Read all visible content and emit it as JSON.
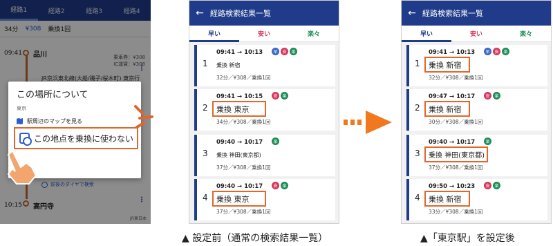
{
  "left_panel": {
    "tabs": [
      "経路1",
      "経路2",
      "経路3",
      "経路4"
    ],
    "summary": {
      "duration": "34分",
      "fare": "¥308",
      "transfers": "乗換1回"
    },
    "origin": {
      "time": "09:41",
      "station": "品川"
    },
    "meta": [
      "乗車券：¥308",
      "IC運賃：¥308"
    ],
    "rail_line": "JR京浜東北線(大船/磯子/桜木町) 東京行",
    "dest": {
      "time": "10:15",
      "station": "高円寺"
    },
    "diagram_link": "前後のダイヤで検索",
    "logo": "JR東日本",
    "kebab": "⋮",
    "dialog": {
      "title": "この場所について",
      "subtitle": "東京",
      "map_item": "駅周辺のマップを見る",
      "option": "この地点を乗換に使わない"
    }
  },
  "screen_before": {
    "title": "経路検索結果一覧",
    "back": "←",
    "tabs": [
      "早い",
      "安い",
      "楽々"
    ],
    "routes": [
      {
        "num": "1",
        "times": "09:41 → 10:13",
        "transfer": "乗換 新宿",
        "detail": "32分／¥308／乗換1回",
        "badges": [
          "早",
          "安",
          "楽"
        ]
      },
      {
        "num": "2",
        "times": "09:41 → 10:15",
        "transfer": "乗換 東京",
        "detail": "34分／¥308／乗換1回",
        "badges": [
          "安",
          "楽"
        ]
      },
      {
        "num": "3",
        "times": "09:40 → 10:17",
        "transfer": "乗換 神田(東京都)",
        "detail": "37分／¥308／乗換1回",
        "badges": [
          "楽"
        ]
      },
      {
        "num": "4",
        "times": "09:40 → 10:17",
        "transfer": "乗換 東京",
        "detail": "37分／¥308／乗換1回",
        "badges": [
          "安",
          "楽"
        ]
      }
    ]
  },
  "screen_after": {
    "title": "経路検索結果一覧",
    "back": "←",
    "tabs": [
      "早い",
      "安い",
      "楽々"
    ],
    "routes": [
      {
        "num": "1",
        "times": "09:41 → 10:13",
        "transfer": "乗換 新宿",
        "detail": "32分／¥308／乗換1回",
        "badges": [
          "早",
          "安",
          "楽"
        ]
      },
      {
        "num": "2",
        "times": "09:47 → 10:17",
        "transfer": "乗換 新宿",
        "detail": "30分／¥308／乗換1回",
        "badges": [
          "安",
          "楽"
        ]
      },
      {
        "num": "3",
        "times": "09:40 → 10:17",
        "transfer": "乗換 神田(東京都)",
        "detail": "37分／¥308／乗換1回",
        "badges": [
          "楽"
        ]
      },
      {
        "num": "4",
        "times": "09:50 → 10:23",
        "transfer": "乗換 新宿",
        "detail": "33分／¥308／乗換1回",
        "badges": [
          "安",
          "楽"
        ]
      }
    ]
  },
  "captions": {
    "before": "▲ 設定前（通常の検索結果一覧）",
    "after": "▲「東京駅」を設定後"
  },
  "colors": {
    "primary": "#1f3b8a",
    "highlight": "#e2662a",
    "cheap": "#d6375e",
    "easy": "#1a8b55",
    "fast_badge": "#3a68c8"
  }
}
